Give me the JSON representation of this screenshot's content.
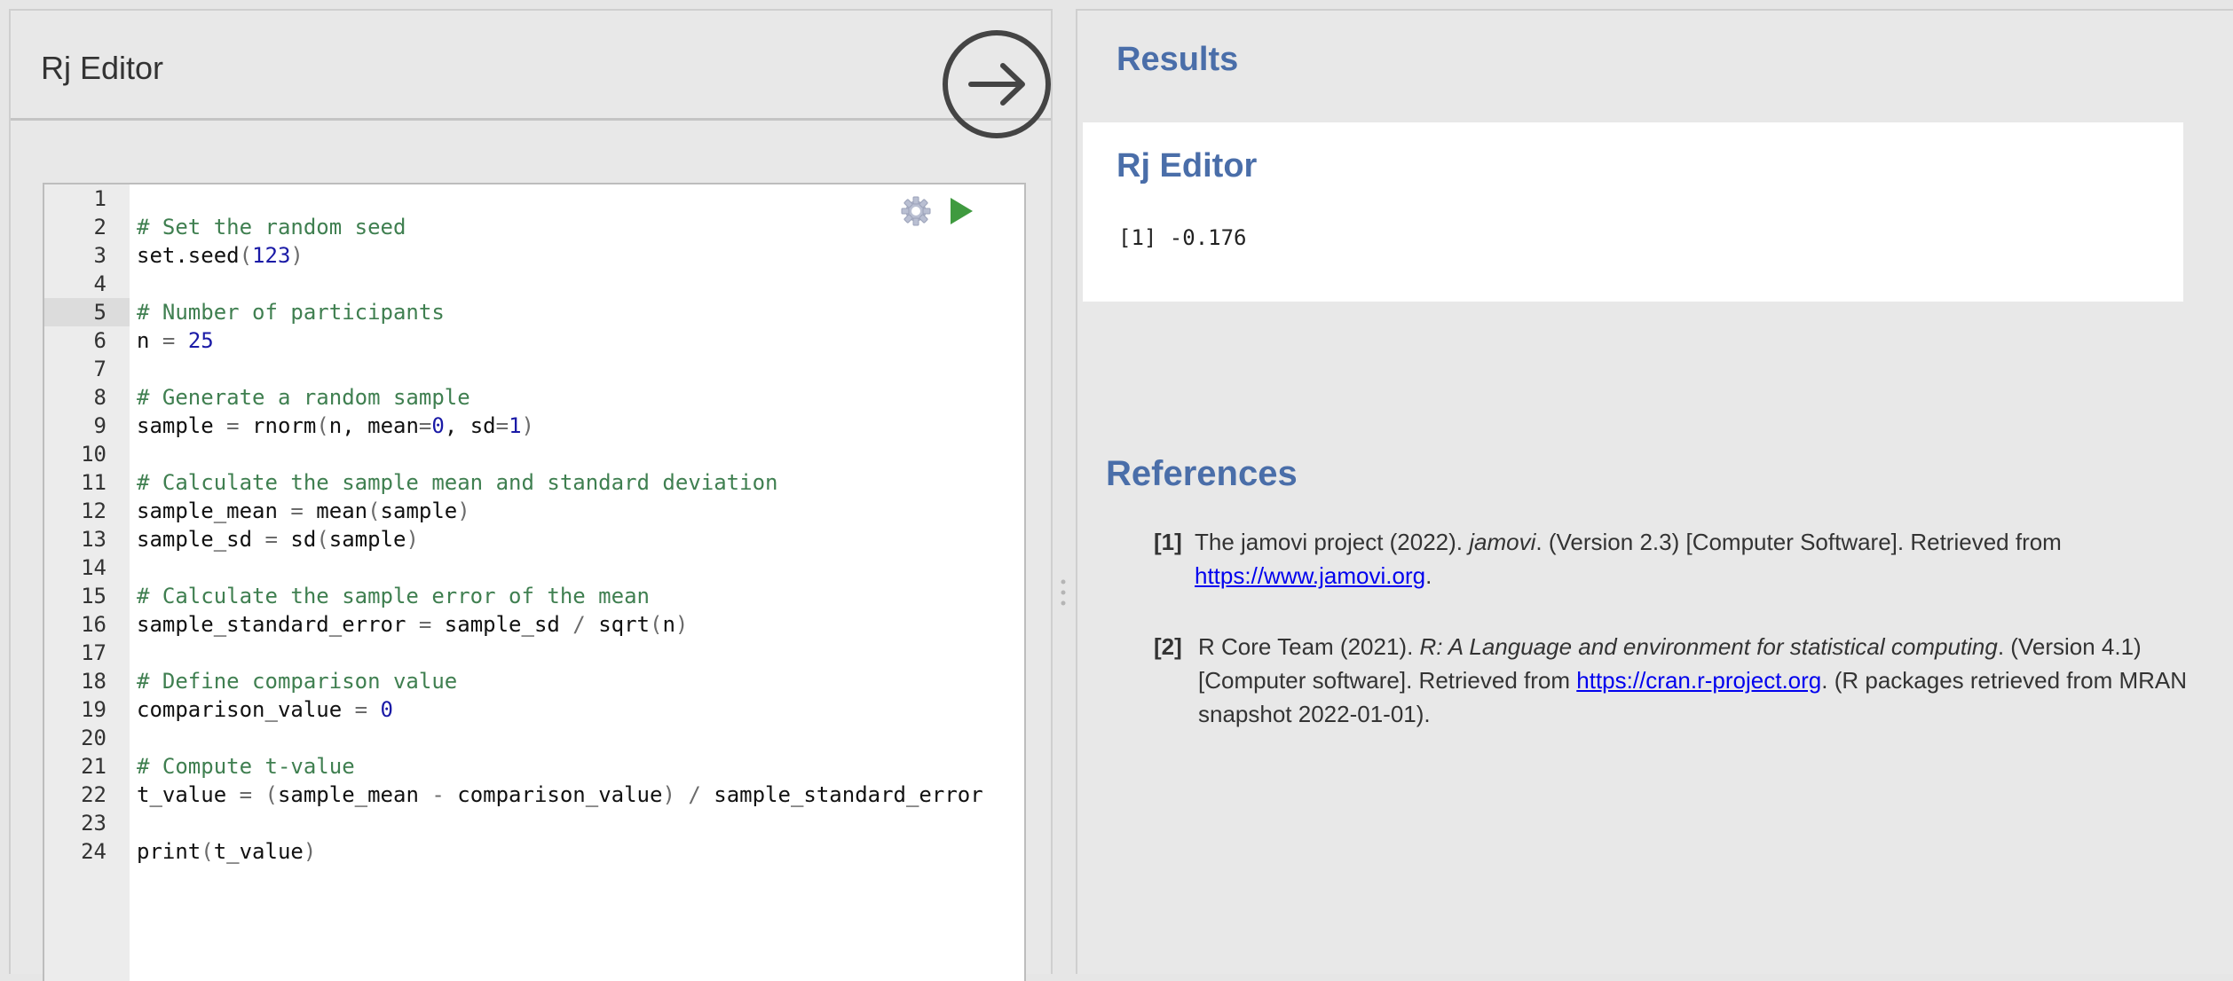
{
  "editor": {
    "title": "Rj Editor",
    "line_numbers": [
      "1",
      "2",
      "3",
      "4",
      "5",
      "6",
      "7",
      "8",
      "9",
      "10",
      "11",
      "12",
      "13",
      "14",
      "15",
      "16",
      "17",
      "18",
      "19",
      "20",
      "21",
      "22",
      "23",
      "24"
    ],
    "active_line": "5"
  },
  "results": {
    "heading": "Results",
    "card_title": "Rj Editor",
    "output": "[1] -0.176"
  },
  "references": {
    "heading": "References",
    "items": [
      {
        "num": "[1]",
        "text_before": "The jamovi project (2022). ",
        "italic": "jamovi",
        "text_after": ". (Version 2.3) [Computer Software]. Retrieved from ",
        "link": "https://www.jamovi.org",
        "tail": "."
      },
      {
        "num": "[2]",
        "text_before": "R Core Team (2021). ",
        "italic": "R: A Language and environment for statistical computing",
        "text_after": ". (Version 4.1) [Computer software]. Retrieved from ",
        "link": "https://cran.r-project.org",
        "tail": ". (R packages retrieved from MRAN snapshot 2022-01-01)."
      }
    ]
  },
  "colors": {
    "accent": "#4a6ea9",
    "comment": "#3f7f50",
    "number": "#1a1aa6",
    "run_green": "#3f9a3f"
  },
  "icons": [
    "arrow-right-circle-icon",
    "gear-icon",
    "play-icon"
  ]
}
